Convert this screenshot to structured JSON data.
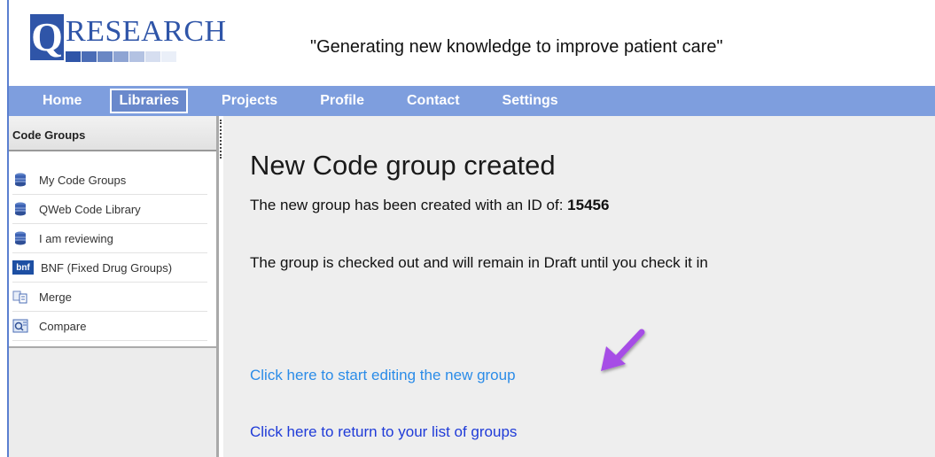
{
  "brand": {
    "logo_letter": "Q",
    "logo_word": "RESEARCH",
    "tagline": "\"Generating new knowledge to improve patient care\""
  },
  "nav": {
    "items": [
      {
        "label": "Home"
      },
      {
        "label": "Libraries",
        "active": true
      },
      {
        "label": "Projects"
      },
      {
        "label": "Profile"
      },
      {
        "label": "Contact"
      },
      {
        "label": "Settings"
      }
    ]
  },
  "sidebar": {
    "title": "Code Groups",
    "items": [
      {
        "label": "My Code Groups",
        "icon": "database-icon"
      },
      {
        "label": "QWeb Code Library",
        "icon": "database-icon"
      },
      {
        "label": "I am reviewing",
        "icon": "database-icon"
      },
      {
        "label": "BNF (Fixed Drug Groups)",
        "icon": "bnf-icon",
        "icon_text": "bnf"
      },
      {
        "label": "Merge",
        "icon": "merge-icon"
      },
      {
        "label": "Compare",
        "icon": "compare-icon"
      }
    ]
  },
  "main": {
    "title": "New Code group created",
    "created_text": "The new group has been created with an ID of: ",
    "group_id": "15456",
    "status_text": "The group is checked out and will remain in Draft until you check it in",
    "edit_link": "Click here to start editing the new group",
    "return_link": "Click here to return to your list of groups"
  },
  "colors": {
    "nav_bg": "#7e9ede",
    "brand_blue": "#2f55a8",
    "link_light": "#2b8ce8",
    "link_dark": "#1f3bd8",
    "arrow": "#a64de6"
  }
}
